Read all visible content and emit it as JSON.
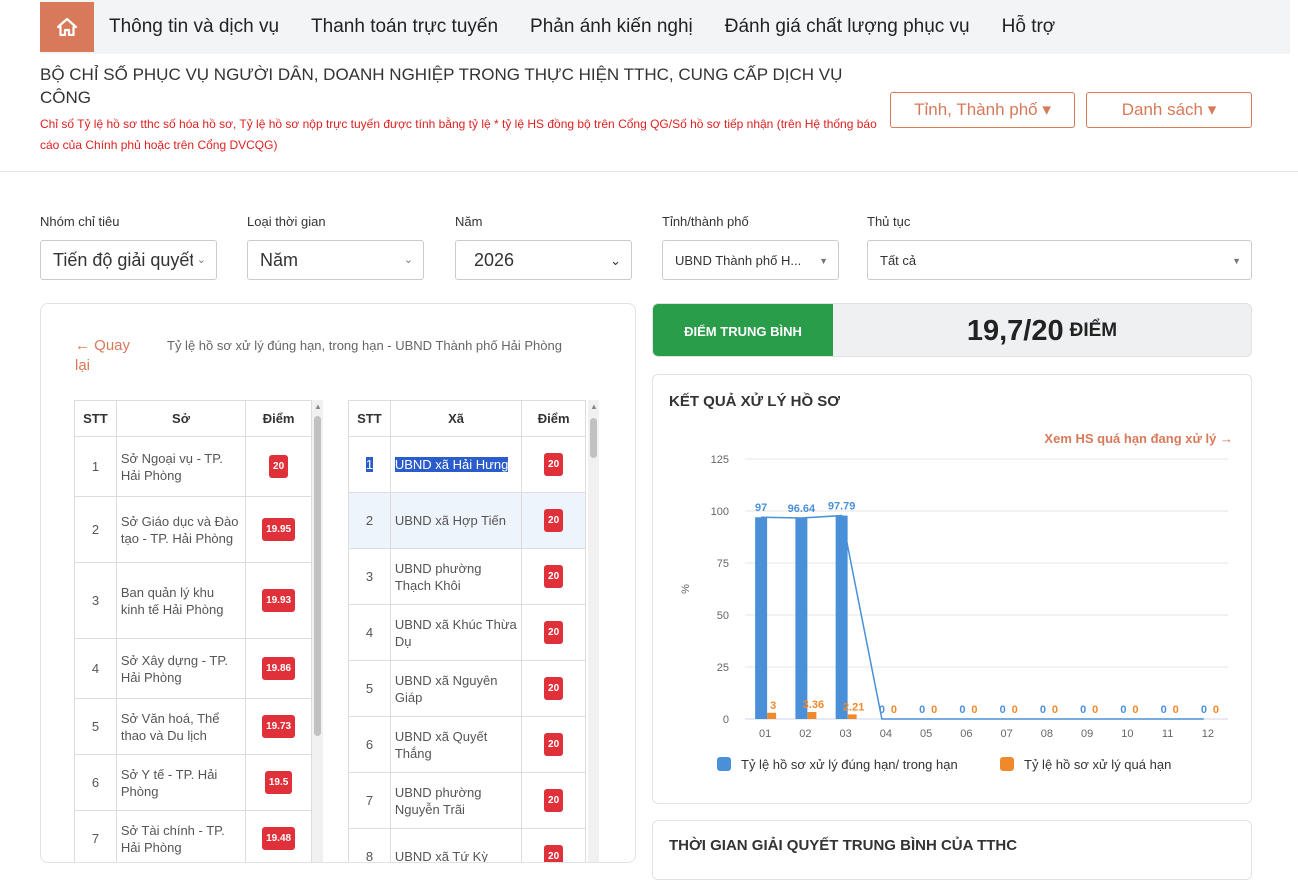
{
  "nav": {
    "items": [
      "Thông tin và dịch vụ",
      "Thanh toán trực tuyến",
      "Phản ánh kiến nghị",
      "Đánh giá chất lượng phục vụ",
      "Hỗ trợ"
    ]
  },
  "header": {
    "title": "BỘ CHỈ SỐ PHỤC VỤ NGƯỜI DÂN, DOANH NGHIỆP TRONG THỰC HIỆN TTHC, CUNG CẤP DỊCH VỤ CÔNG",
    "note": "Chỉ số Tỷ lệ hồ sơ tthc số hóa hồ sơ, Tỷ lệ hồ sơ nộp trực tuyến được tính bằng tỷ lệ * tỷ lệ HS đồng bộ trên Cổng QG/Số hồ sơ tiếp nhận (trên Hệ thống báo cáo của Chính phủ hoặc trên Cổng DVCQG)",
    "province_button": "Tỉnh, Thành phố ▾",
    "list_button": "Danh sách ▾"
  },
  "filters": {
    "group_label": "Nhóm chỉ tiêu",
    "group_value": "Tiến độ giải quyết",
    "time_label": "Loại thời gian",
    "time_value": "Năm",
    "year_label": "Năm",
    "year_value": "2026",
    "province_label": "Tỉnh/thành phố",
    "province_value": "UBND Thành phố H...",
    "procedure_label": "Thủ tục",
    "procedure_value": "Tất cả"
  },
  "left_panel": {
    "back": "← Quay lại",
    "desc": "Tỷ lệ hồ sơ xử lý đúng hạn, trong hạn - UBND Thành phố Hải Phòng",
    "so_table": {
      "headers": [
        "STT",
        "Sở",
        "Điểm"
      ],
      "rows": [
        {
          "stt": "1",
          "name": "Sở Ngoại vụ - TP. Hải Phòng",
          "score": "20"
        },
        {
          "stt": "2",
          "name": "Sở Giáo dục và Đào tạo - TP. Hải Phòng",
          "score": "19.95"
        },
        {
          "stt": "3",
          "name": "Ban quản lý khu kinh tế Hải Phòng",
          "score": "19.93"
        },
        {
          "stt": "4",
          "name": "Sở Xây dựng - TP. Hải Phòng",
          "score": "19.86"
        },
        {
          "stt": "5",
          "name": "Sở Văn hoá, Thể thao và Du lịch",
          "score": "19.73"
        },
        {
          "stt": "6",
          "name": "Sở Y tế - TP. Hải Phòng",
          "score": "19.5"
        },
        {
          "stt": "7",
          "name": "Sở Tài chính - TP. Hải Phòng",
          "score": "19.48"
        }
      ]
    },
    "xa_table": {
      "headers": [
        "STT",
        "Xã",
        "Điểm"
      ],
      "rows": [
        {
          "stt": "1",
          "name": "UBND xã Hải Hưng",
          "score": "20"
        },
        {
          "stt": "2",
          "name": "UBND xã Hợp Tiến",
          "score": "20"
        },
        {
          "stt": "3",
          "name": "UBND phường Thạch Khôi",
          "score": "20"
        },
        {
          "stt": "4",
          "name": "UBND xã Khúc Thừa Dụ",
          "score": "20"
        },
        {
          "stt": "5",
          "name": "UBND xã Nguyên Giáp",
          "score": "20"
        },
        {
          "stt": "6",
          "name": "UBND xã Quyết Thắng",
          "score": "20"
        },
        {
          "stt": "7",
          "name": "UBND phường Nguyễn Trãi",
          "score": "20"
        },
        {
          "stt": "8",
          "name": "UBND xã Tứ Kỳ",
          "score": "20"
        }
      ]
    }
  },
  "score": {
    "label": "ĐIỂM TRUNG BÌNH",
    "value": "19,7/20",
    "unit": "ĐIỂM"
  },
  "chart_card": {
    "title": "KẾT QUẢ XỬ LÝ HỒ SƠ",
    "link": "Xem HS quá hạn đang xử lý →"
  },
  "card2": {
    "title": "THỜI GIAN GIẢI QUYẾT TRUNG BÌNH CỦA TTHC"
  },
  "chart_data": {
    "type": "bar",
    "categories": [
      "01",
      "02",
      "03",
      "04",
      "05",
      "06",
      "07",
      "08",
      "09",
      "10",
      "11",
      "12"
    ],
    "ylabel": "%",
    "ylim": [
      0,
      125
    ],
    "yticks": [
      0,
      25,
      50,
      75,
      100,
      125
    ],
    "grid": true,
    "legend_position": "bottom",
    "series": [
      {
        "name": "Tỷ lệ hồ sơ xử lý đúng hạn/ trong hạn",
        "color": "#4a90d9",
        "values": [
          97,
          96.64,
          97.79,
          0,
          0,
          0,
          0,
          0,
          0,
          0,
          0,
          0
        ],
        "labels": [
          "97",
          "96.64",
          "97.79",
          "0",
          "0",
          "0",
          "0",
          "0",
          "0",
          "0",
          "0",
          "0"
        ]
      },
      {
        "name": "Tỷ lệ hồ sơ xử lý quá hạn",
        "color": "#f0892c",
        "values": [
          3,
          3.36,
          2.21,
          0,
          0,
          0,
          0,
          0,
          0,
          0,
          0,
          0
        ],
        "labels": [
          "3",
          "3.36",
          "2.21",
          "0",
          "0",
          "0",
          "0",
          "0",
          "0",
          "0",
          "0",
          "0"
        ]
      }
    ]
  }
}
